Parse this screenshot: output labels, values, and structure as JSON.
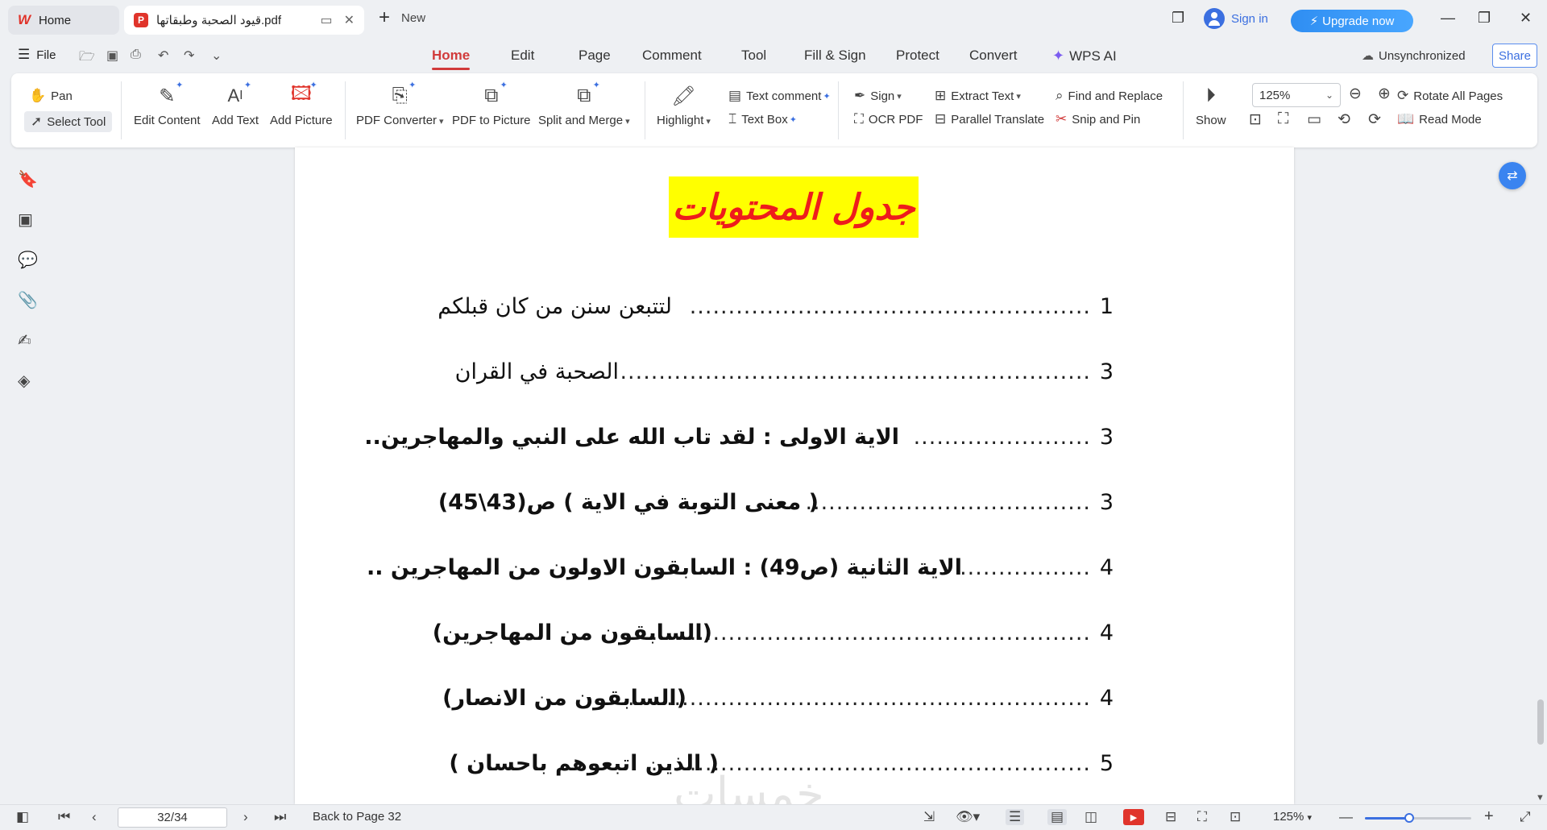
{
  "tabs": {
    "home_label": "Home",
    "doc_label": "قيود الصحبة وطبقاتها.pdf",
    "new_label": "New"
  },
  "account": {
    "signin": "Sign in",
    "upgrade": "Upgrade now"
  },
  "menu": {
    "file": "File",
    "tabs": [
      "Home",
      "Edit",
      "Page",
      "Comment",
      "Tool",
      "Fill & Sign",
      "Protect",
      "Convert",
      "WPS AI"
    ],
    "active_tab": "Home",
    "sync_status": "Unsynchronized",
    "share": "Share"
  },
  "ribbon": {
    "pan": "Pan",
    "select_tool": "Select Tool",
    "edit_content": "Edit Content",
    "add_text": "Add Text",
    "add_picture": "Add Picture",
    "pdf_converter": "PDF Converter",
    "pdf_to_picture": "PDF to Picture",
    "split_merge": "Split and Merge",
    "highlight": "Highlight",
    "text_comment": "Text comment",
    "text_box": "Text Box",
    "sign": "Sign",
    "ocr_pdf": "OCR PDF",
    "extract_text": "Extract Text",
    "parallel_translate": "Parallel Translate",
    "find_replace": "Find and Replace",
    "snip_pin": "Snip and Pin",
    "show": "Show",
    "zoom": "125%",
    "rotate_all": "Rotate All Pages",
    "read_mode": "Read Mode"
  },
  "document": {
    "title": "جدول المحتويات",
    "toc": [
      {
        "num": "1",
        "text": "لتتبعن سنن من كان قبلكم",
        "dots": "....................................................",
        "bold": false
      },
      {
        "num": "3",
        "text": "الصحبة في القران",
        "dots": ".............................................................",
        "bold": false
      },
      {
        "num": "3",
        "text": "الاية الاولى : لقد تاب الله على النبي والمهاجرين..",
        "dots": ".......................",
        "bold": true
      },
      {
        "num": "3",
        "text": "( معنى التوبة في الاية ) ص(43\\45)",
        "dots": ".....................................",
        "bold": true
      },
      {
        "num": "4",
        "text": "الاية الثانية (ص49) : السابقون الاولون من المهاجرين ..",
        "dots": ".................",
        "bold": true
      },
      {
        "num": "4",
        "text": "(السابقون من المهاجرين)",
        "dots": "..........................................................",
        "bold": true
      },
      {
        "num": "4",
        "text": "(السابقون من الانصار)",
        "dots": ".............................................................",
        "bold": true
      },
      {
        "num": "5",
        "text": "( الذين اتبعوهم باحسان )",
        "dots": ".........................................................",
        "bold": true
      }
    ],
    "watermark": "خمسات"
  },
  "statusbar": {
    "page": "32/34",
    "back_to_page": "Back to Page 32",
    "zoom": "125%",
    "zoom_level": 0.42
  },
  "colors": {
    "accent": "#d13b3b",
    "brand_blue": "#3b6fe0",
    "title_highlight": "#ffff00",
    "title_text": "#ee1c1c"
  }
}
